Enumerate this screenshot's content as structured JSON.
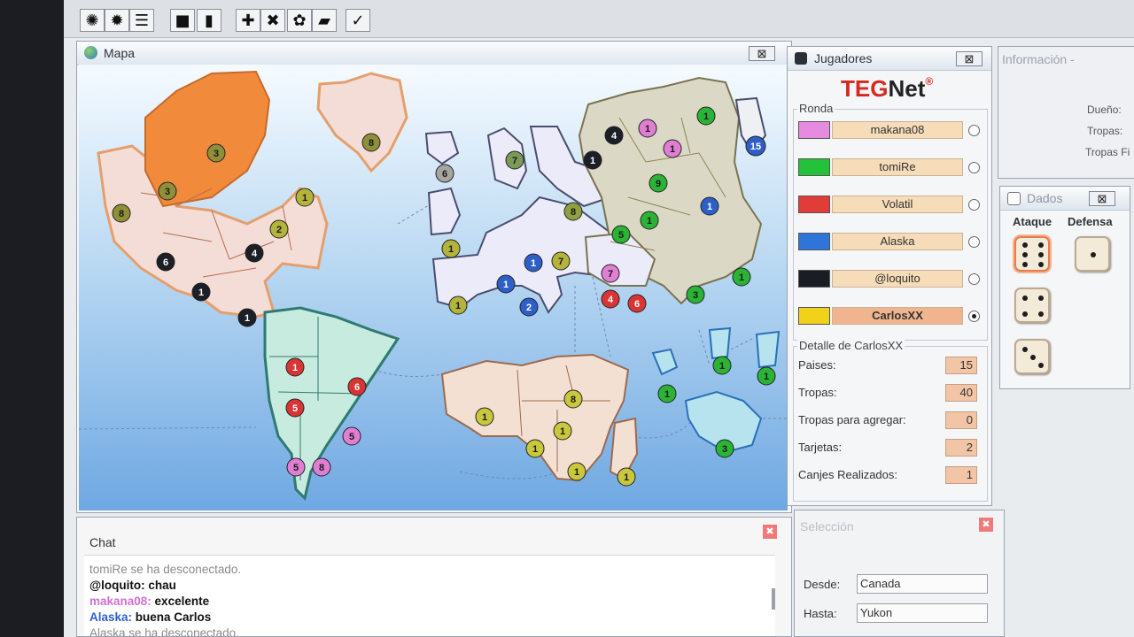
{
  "toolbar": {
    "buttons": [
      {
        "icon": "globe-icon",
        "glyph": "✺"
      },
      {
        "icon": "gear-icon",
        "glyph": "✹"
      },
      {
        "icon": "list-icon",
        "glyph": "☰"
      },
      {
        "icon": "window-icon",
        "glyph": "■"
      },
      {
        "icon": "flag-icon",
        "glyph": "▮"
      },
      {
        "icon": "plus-icon",
        "glyph": "✚"
      },
      {
        "icon": "cross-icon",
        "glyph": "✖"
      },
      {
        "icon": "refresh-icon",
        "glyph": "✿"
      },
      {
        "icon": "card-icon",
        "glyph": "▰"
      },
      {
        "icon": "check-icon",
        "glyph": "✓"
      }
    ]
  },
  "map": {
    "title": "Mapa",
    "close": "⊠",
    "armies": [
      {
        "n": "3",
        "c": "#8f8f3a"
      },
      {
        "n": "3",
        "c": "#8f8f3a"
      },
      {
        "n": "8",
        "c": "#8f8f3a"
      },
      {
        "n": "1",
        "c": "#b4b43c"
      },
      {
        "n": "2",
        "c": "#b4b43c"
      },
      {
        "n": "6",
        "c": "#1c1f26"
      },
      {
        "n": "4",
        "c": "#1c1f26"
      },
      {
        "n": "1",
        "c": "#1c1f26"
      },
      {
        "n": "1",
        "c": "#1c1f26"
      },
      {
        "n": "8",
        "c": "#8f8f3a"
      },
      {
        "n": "6",
        "c": "#a6a6a0"
      },
      {
        "n": "7",
        "c": "#7a9a5a"
      },
      {
        "n": "1",
        "c": "#b4b43c"
      },
      {
        "n": "8",
        "c": "#8fa040"
      },
      {
        "n": "1",
        "c": "#b4b43c"
      },
      {
        "n": "1",
        "c": "#2e5fc9"
      },
      {
        "n": "1",
        "c": "#2e5fc9"
      },
      {
        "n": "7",
        "c": "#b4b43c"
      },
      {
        "n": "2",
        "c": "#2e5fc9"
      },
      {
        "n": "4",
        "c": "#1c1f26"
      },
      {
        "n": "1",
        "c": "#1c1f26"
      },
      {
        "n": "1",
        "c": "#e07ed4"
      },
      {
        "n": "1",
        "c": "#e07ed4"
      },
      {
        "n": "1",
        "c": "#2bb336"
      },
      {
        "n": "15",
        "c": "#2e5fc9"
      },
      {
        "n": "9",
        "c": "#2bb336"
      },
      {
        "n": "1",
        "c": "#2bb336"
      },
      {
        "n": "1",
        "c": "#2e5fc9"
      },
      {
        "n": "5",
        "c": "#2bb336"
      },
      {
        "n": "7",
        "c": "#e07ed4"
      },
      {
        "n": "4",
        "c": "#d93535"
      },
      {
        "n": "6",
        "c": "#d93535"
      },
      {
        "n": "3",
        "c": "#2bb336"
      },
      {
        "n": "1",
        "c": "#2bb336"
      },
      {
        "n": "1",
        "c": "#d93535"
      },
      {
        "n": "6",
        "c": "#d93535"
      },
      {
        "n": "5",
        "c": "#d93535"
      },
      {
        "n": "5",
        "c": "#e07ed4"
      },
      {
        "n": "5",
        "c": "#e07ed4"
      },
      {
        "n": "8",
        "c": "#e07ed4"
      },
      {
        "n": "1",
        "c": "#c9c73b"
      },
      {
        "n": "8",
        "c": "#c9c73b"
      },
      {
        "n": "1",
        "c": "#c9c73b"
      },
      {
        "n": "1",
        "c": "#c9c73b"
      },
      {
        "n": "1",
        "c": "#c9c73b"
      },
      {
        "n": "1",
        "c": "#c9c73b"
      },
      {
        "n": "1",
        "c": "#2bb336"
      },
      {
        "n": "1",
        "c": "#2bb336"
      },
      {
        "n": "1",
        "c": "#2bb336"
      },
      {
        "n": "3",
        "c": "#2bb336"
      }
    ]
  },
  "jugadores": {
    "title": "Jugadores",
    "close": "⊠",
    "brand_red": "TEG",
    "brand_black": "Net",
    "brand_mark": "®",
    "ronda_label": "Ronda",
    "players": [
      {
        "name": "makana08",
        "color": "#e58be0",
        "selected": false
      },
      {
        "name": "tomiRe",
        "color": "#23c23a",
        "selected": false
      },
      {
        "name": "Volatil",
        "color": "#e23c38",
        "selected": false
      },
      {
        "name": "Alaska",
        "color": "#2f74d8",
        "selected": false
      },
      {
        "name": "@loquito",
        "color": "#1a1d24",
        "selected": false
      },
      {
        "name": "CarlosXX",
        "color": "#f0d21a",
        "selected": true
      }
    ],
    "detalle_label": "Detalle de CarlosXX",
    "details": [
      {
        "label": "Paises:",
        "value": "15"
      },
      {
        "label": "Tropas:",
        "value": "40"
      },
      {
        "label": "Tropas para agregar:",
        "value": "0"
      },
      {
        "label": "Tarjetas:",
        "value": "2"
      },
      {
        "label": "Canjes Realizados:",
        "value": "1"
      }
    ]
  },
  "info": {
    "title": "Información -",
    "rows": [
      "Dueño:",
      "Tropas:",
      "Tropas Fi"
    ]
  },
  "dados": {
    "title": "Dados",
    "close": "⊠",
    "ataque": "Ataque",
    "defensa": "Defensa",
    "attack_dice": [
      6,
      4,
      3
    ],
    "defense_dice": [
      1
    ]
  },
  "chat": {
    "title": "Chat",
    "close": "✖",
    "lines": [
      {
        "user": "",
        "text": "tomiRe se ha desconectado.",
        "ucolor": "#8a8a8a",
        "tcolor": "#8a8a8a"
      },
      {
        "user": "@loquito:",
        "text": " chau",
        "ucolor": "#111111",
        "tcolor": "#111111"
      },
      {
        "user": "makana08:",
        "text": " excelente",
        "ucolor": "#d070cf",
        "tcolor": "#111111"
      },
      {
        "user": "Alaska:",
        "text": " buena Carlos",
        "ucolor": "#2f5fd0",
        "tcolor": "#111111"
      },
      {
        "user": "",
        "text": "Alaska se ha desconectado.",
        "ucolor": "#8a8a8a",
        "tcolor": "#8a8a8a"
      }
    ]
  },
  "seleccion": {
    "title": "Selección",
    "close": "✖",
    "desde_label": "Desde:",
    "desde_value": "Canada",
    "hasta_label": "Hasta:",
    "hasta_value": "Yukon"
  }
}
